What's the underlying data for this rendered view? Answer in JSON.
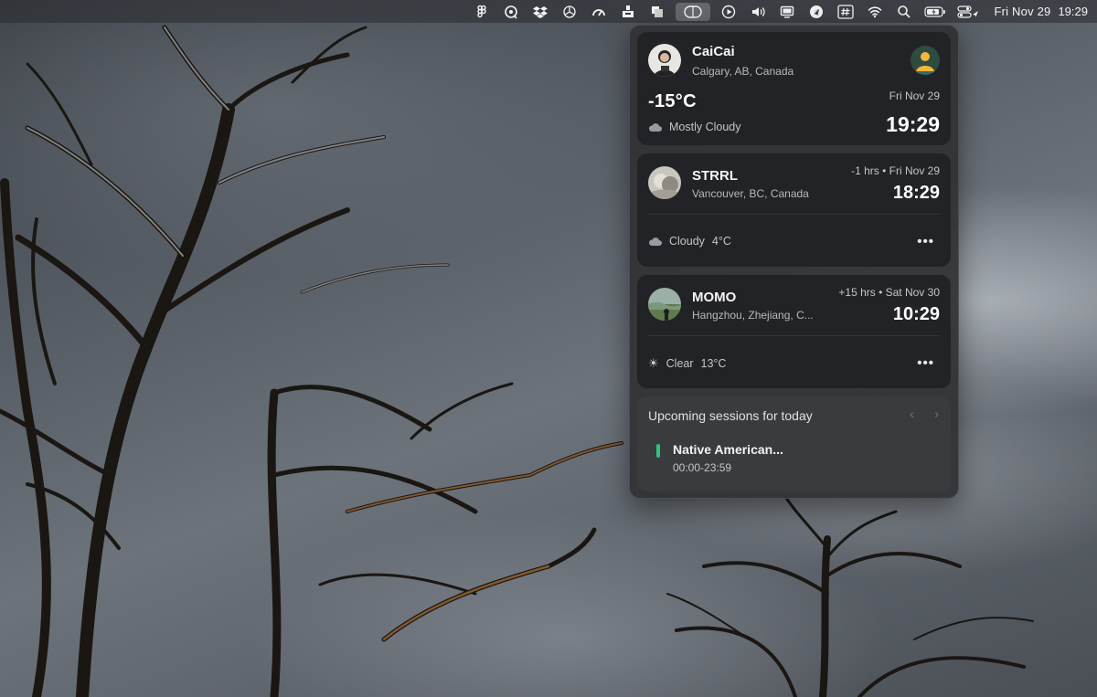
{
  "menubar": {
    "icons": [
      "figma-icon",
      "chrome-remote-icon",
      "dropbox-icon",
      "openai-icon",
      "speedometer-icon",
      "upload-tray-icon",
      "stack-icon",
      "world-clock-icon",
      "play-icon",
      "volume-icon",
      "display-icon",
      "telegram-icon",
      "hashtag-icon",
      "wifi-icon",
      "search-icon",
      "battery-icon",
      "control-center-icon"
    ],
    "date": "Fri Nov 29",
    "time": "19:29"
  },
  "main": {
    "name": "CaiCai",
    "location": "Calgary, AB, Canada",
    "temperature": "-15°C",
    "condition": "Mostly Cloudy",
    "condition_icon": "cloud-icon",
    "date": "Fri Nov 29",
    "time": "19:29"
  },
  "friends": [
    {
      "name": "STRRL",
      "location": "Vancouver, BC, Canada",
      "offset": "-1 hrs • Fri Nov 29",
      "time": "18:29",
      "condition": "Cloudy",
      "temperature": "4°C",
      "condition_icon": "cloud-icon"
    },
    {
      "name": "MOMO",
      "location": "Hangzhou, Zhejiang, C...",
      "offset": "+15 hrs • Sat Nov 30",
      "time": "10:29",
      "condition": "Clear",
      "temperature": "13°C",
      "condition_icon": "sun-icon"
    }
  ],
  "sessions": {
    "title": "Upcoming sessions for today",
    "prev_glyph": "‹",
    "next_glyph": "›",
    "items": [
      {
        "name": "Native American...",
        "time": "00:00-23:59"
      }
    ]
  },
  "more_glyph": "•••",
  "colors": {
    "session_accent": "#2ec27e",
    "card_bg": "#222326",
    "panel_bg": "#303134"
  }
}
